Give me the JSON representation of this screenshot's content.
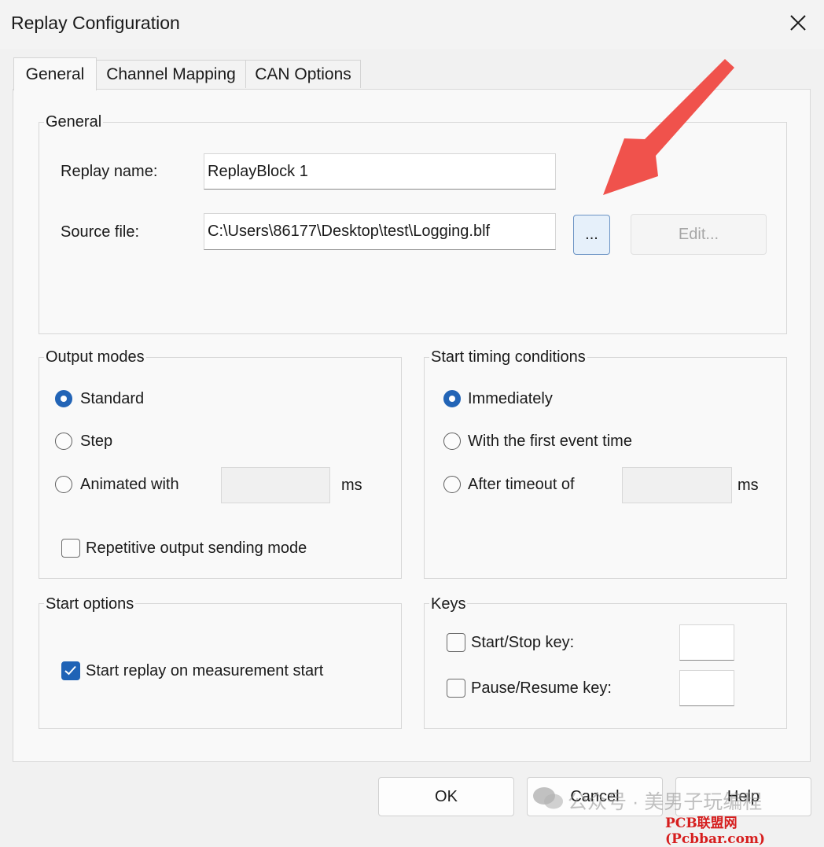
{
  "window": {
    "title": "Replay Configuration"
  },
  "tabs": [
    {
      "label": "General",
      "active": true
    },
    {
      "label": "Channel Mapping",
      "active": false
    },
    {
      "label": "CAN Options",
      "active": false
    }
  ],
  "general_group": {
    "title": "General",
    "replay_name_label": "Replay name:",
    "replay_name_value": "ReplayBlock 1",
    "source_file_label": "Source file:",
    "source_file_value": "C:\\Users\\86177\\Desktop\\test\\Logging.blf",
    "browse_label": "...",
    "edit_label": "Edit..."
  },
  "output_modes": {
    "title": "Output modes",
    "standard_label": "Standard",
    "step_label": "Step",
    "animated_label": "Animated with",
    "animated_value": "",
    "animated_unit": "ms",
    "repetitive_label": "Repetitive output sending mode",
    "selected": "Standard",
    "repetitive_checked": false
  },
  "start_timing": {
    "title": "Start timing conditions",
    "immediately_label": "Immediately",
    "first_event_label": "With the first event time",
    "timeout_label": "After timeout of",
    "timeout_value": "",
    "timeout_unit": "ms",
    "selected": "Immediately"
  },
  "start_options": {
    "title": "Start options",
    "start_replay_label": "Start replay on measurement start",
    "start_replay_checked": true
  },
  "keys": {
    "title": "Keys",
    "start_stop_label": "Start/Stop key:",
    "pause_resume_label": "Pause/Resume key:",
    "start_stop_value": "",
    "pause_resume_value": ""
  },
  "buttons": {
    "ok": "OK",
    "cancel": "Cancel",
    "help": "Help"
  },
  "watermark": {
    "line1": "公众号 · 美男子玩编程",
    "line2": "PCB联盟网(Pcbbar.com)"
  },
  "colors": {
    "accent": "#2264b6",
    "arrow": "#f0524c",
    "panel": "#f9f9f9",
    "window": "#f1f1f1"
  }
}
